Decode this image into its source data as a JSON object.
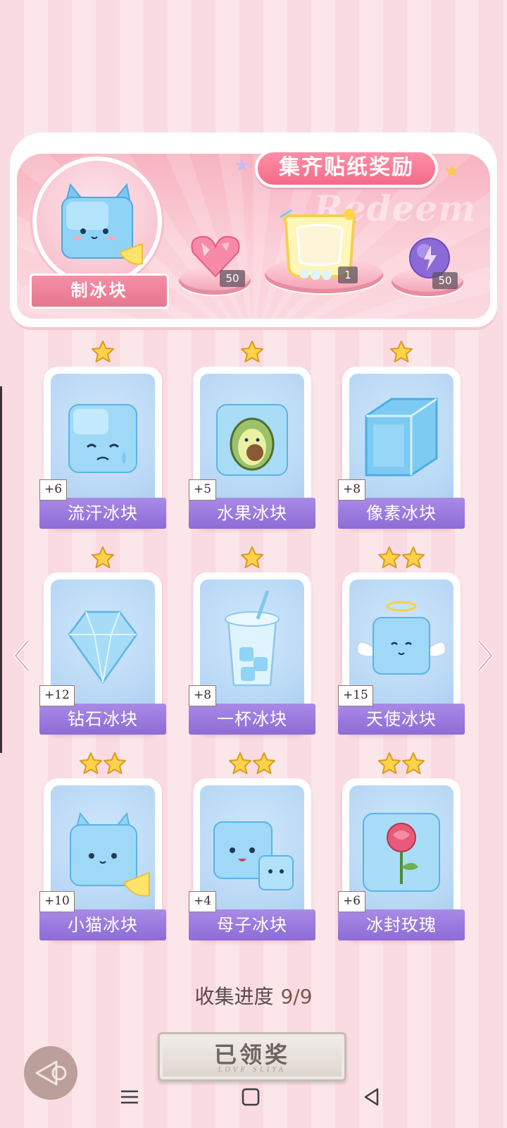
{
  "banner": {
    "title": "集齐贴纸奖励",
    "watermark": "Redeem",
    "maker_label": "制冰块",
    "rewards": [
      {
        "icon": "pink-heart-gem-icon",
        "count": "50"
      },
      {
        "icon": "lemonade-frame-icon",
        "count": "1"
      },
      {
        "icon": "purple-energy-orb-icon",
        "count": "50"
      }
    ]
  },
  "cards": [
    {
      "name": "流汗冰块",
      "bonus": "+6",
      "stars": 1,
      "icon": "sweating-ice-cube-icon"
    },
    {
      "name": "水果冰块",
      "bonus": "+5",
      "stars": 1,
      "icon": "avocado-ice-cube-icon"
    },
    {
      "name": "像素冰块",
      "bonus": "+8",
      "stars": 1,
      "icon": "pixel-ice-cube-icon"
    },
    {
      "name": "钻石冰块",
      "bonus": "+12",
      "stars": 1,
      "icon": "diamond-ice-icon"
    },
    {
      "name": "一杯冰块",
      "bonus": "+8",
      "stars": 1,
      "icon": "cup-of-ice-icon"
    },
    {
      "name": "天使冰块",
      "bonus": "+15",
      "stars": 2,
      "icon": "angel-ice-cube-icon"
    },
    {
      "name": "小猫冰块",
      "bonus": "+10",
      "stars": 2,
      "icon": "cat-ice-cube-icon"
    },
    {
      "name": "母子冰块",
      "bonus": "+4",
      "stars": 2,
      "icon": "mother-child-ice-cubes-icon"
    },
    {
      "name": "冰封玫瑰",
      "bonus": "+6",
      "stars": 2,
      "icon": "frozen-rose-icon"
    }
  ],
  "progress": {
    "label": "收集进度",
    "value": "9/9"
  },
  "claim_button": {
    "label": "已领奖",
    "subtitle": "LOVE SLIYA"
  },
  "colors": {
    "accent_pink": "#f36b88",
    "label_purple": "#8d6cd6",
    "card_blue": "#b9d8f5"
  }
}
